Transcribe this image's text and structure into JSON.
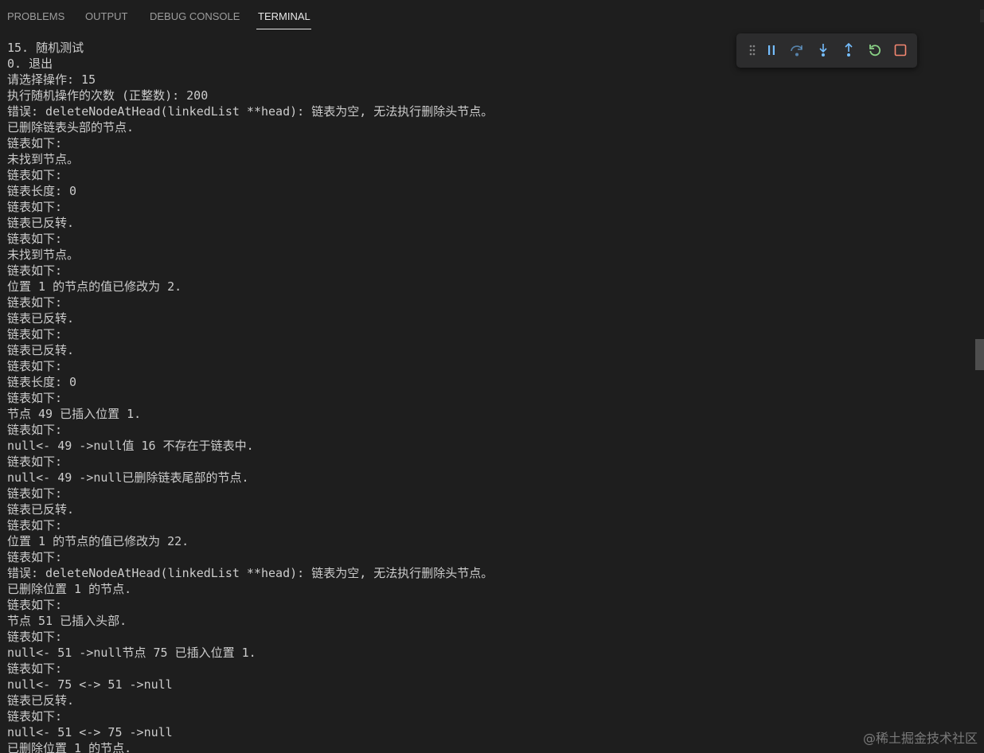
{
  "tabs": [
    {
      "label": "PROBLEMS"
    },
    {
      "label": "OUTPUT"
    },
    {
      "label": "DEBUG CONSOLE"
    },
    {
      "label": "TERMINAL"
    }
  ],
  "active_tab": "TERMINAL",
  "debug_toolbar": {
    "icons": [
      "drag-handle-icon",
      "pause-icon",
      "step-over-icon",
      "step-into-icon",
      "step-out-icon",
      "restart-icon",
      "stop-icon"
    ],
    "colors": {
      "default": "#75beff",
      "restart": "#89d185",
      "stop": "#f48771",
      "drag": "#858585"
    }
  },
  "terminal": {
    "lines": [
      "15. 随机测试",
      "0. 退出",
      "请选择操作: 15",
      "执行随机操作的次数 (正整数): 200",
      "错误: deleteNodeAtHead(linkedList **head): 链表为空, 无法执行删除头节点。",
      "已删除链表头部的节点.",
      "链表如下:",
      "未找到节点。",
      "链表如下:",
      "链表长度: 0",
      "链表如下:",
      "链表已反转.",
      "链表如下:",
      "未找到节点。",
      "链表如下:",
      "位置 1 的节点的值已修改为 2.",
      "链表如下:",
      "链表已反转.",
      "链表如下:",
      "链表已反转.",
      "链表如下:",
      "链表长度: 0",
      "链表如下:",
      "节点 49 已插入位置 1.",
      "链表如下:",
      "null<- 49 ->null值 16 不存在于链表中.",
      "链表如下:",
      "null<- 49 ->null已删除链表尾部的节点.",
      "链表如下:",
      "链表已反转.",
      "链表如下:",
      "位置 1 的节点的值已修改为 22.",
      "链表如下:",
      "错误: deleteNodeAtHead(linkedList **head): 链表为空, 无法执行删除头节点。",
      "已删除位置 1 的节点.",
      "链表如下:",
      "节点 51 已插入头部.",
      "链表如下:",
      "null<- 51 ->null节点 75 已插入位置 1.",
      "链表如下:",
      "null<- 75 <-> 51 ->null",
      "链表已反转.",
      "链表如下:",
      "null<- 51 <-> 75 ->null",
      "已删除位置 1 的节点."
    ]
  },
  "watermark": "@稀土掘金技术社区"
}
